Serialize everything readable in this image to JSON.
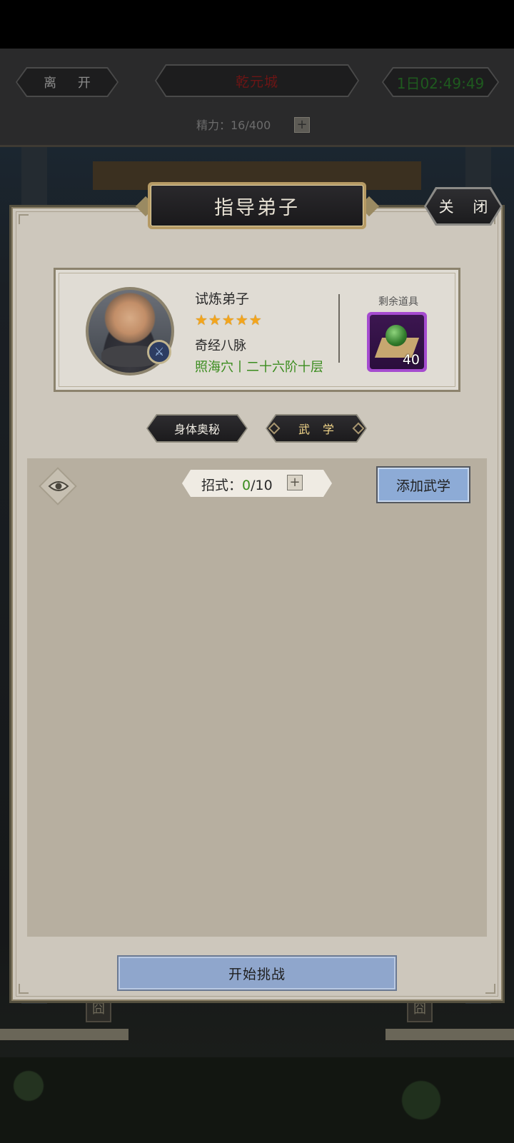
{
  "topbar": {
    "leave_label": "离 开",
    "city_name": "乾元城",
    "timer": "1日02:49:49",
    "energy_text": "精力：16/400",
    "energy_plus": "+"
  },
  "dialog": {
    "title": "指导弟子",
    "close_label": "关 闭"
  },
  "disciple": {
    "name": "试炼弟子",
    "stars_text": "★★★★★",
    "star_count": 5,
    "meridian": "奇经八脉",
    "progress": "照海穴丨二十六阶十层",
    "rank_icon": "sword-icon"
  },
  "item": {
    "label": "剩余道具",
    "count": "40",
    "icon": "green-orb-icon"
  },
  "tabs": [
    {
      "label": "身体奥秘",
      "active": false
    },
    {
      "label": "武学",
      "active": true
    }
  ],
  "moves": {
    "label": "招式：",
    "current": "0",
    "max": "/10",
    "plus": "+"
  },
  "add_martial_label": "添加武学",
  "start_challenge_label": "开始挑战",
  "scene": {
    "panel_glyph": "囧"
  },
  "colors": {
    "accent_green": "#3a8c1e",
    "star_gold": "#f3a51c",
    "button_blue": "#8dabd6",
    "item_purple": "#a54bcf"
  }
}
